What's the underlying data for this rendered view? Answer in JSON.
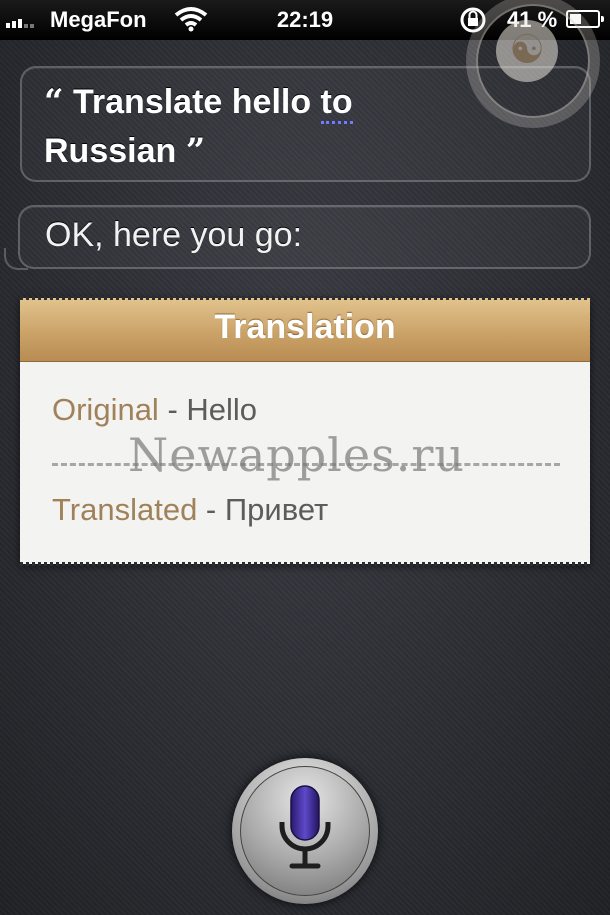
{
  "status_bar": {
    "carrier": "MegaFon",
    "time": "22:19",
    "battery_percent": "41 %",
    "battery_level": 0.41,
    "signal_bars_on": 3,
    "signal_bars_total": 5
  },
  "conversation": {
    "user_query_line1": "Translate hello to",
    "user_query_line2": "Russian",
    "open_quote": "“",
    "close_quote": "”",
    "siri_reply": "OK, here you go:"
  },
  "translation_card": {
    "title": "Translation",
    "original_label": "Original",
    "original_value": "Hello",
    "translated_label": "Translated",
    "translated_value": "Привет",
    "separator": " - ",
    "watermark": "Newapples.ru"
  },
  "icons": {
    "wifi": "wifi-icon",
    "rotation_lock": "rotation-lock-icon",
    "battery": "battery-icon",
    "microphone": "microphone-icon",
    "emblem": "globe-emblem-icon"
  },
  "colors": {
    "card_header": "#c9a066",
    "label_color": "#a0825a",
    "mic_purple": "#3d2a8f"
  }
}
